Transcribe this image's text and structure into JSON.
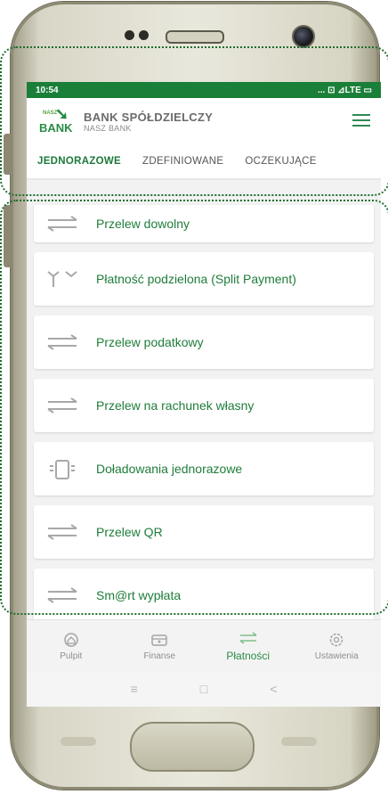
{
  "status_bar": {
    "time": "10:54",
    "indicators": "... ⊡ ⊿LTE ▭"
  },
  "app_bar": {
    "logo_small": "NASZ",
    "logo_text": "BANK",
    "brand_name": "BANK SPÓŁDZIELCZY",
    "brand_sub": "NASZ BANK",
    "menu_icon": "hamburger-icon"
  },
  "tabs": [
    {
      "label": "JEDNORAZOWE",
      "active": true
    },
    {
      "label": "ZDEFINIOWANE",
      "active": false
    },
    {
      "label": "OCZEKUJĄCE",
      "active": false
    }
  ],
  "payment_options": [
    {
      "label": "Przelew dowolny",
      "icon": "transfer-arrows-icon"
    },
    {
      "label": "Płatność podzielona (Split Payment)",
      "icon": "split-payment-icon"
    },
    {
      "label": "Przelew podatkowy",
      "icon": "transfer-arrows-icon"
    },
    {
      "label": "Przelew na rachunek własny",
      "icon": "transfer-arrows-icon"
    },
    {
      "label": "Doładowania jednorazowe",
      "icon": "phone-topup-icon"
    },
    {
      "label": "Przelew QR",
      "icon": "transfer-arrows-icon"
    },
    {
      "label": "Sm@rt wypłata",
      "icon": "transfer-arrows-icon"
    }
  ],
  "bottom_nav": [
    {
      "label": "Pulpit",
      "icon": "home-icon",
      "active": false
    },
    {
      "label": "Finanse",
      "icon": "wallet-icon",
      "active": false
    },
    {
      "label": "Płatności",
      "icon": "transfer-arrows-icon",
      "active": true
    },
    {
      "label": "Ustawienia",
      "icon": "gear-icon",
      "active": false
    }
  ],
  "system_nav": {
    "recent": "≡",
    "home": "□",
    "back": "<"
  },
  "colors": {
    "brand_green": "#1d7a3a",
    "status_bar": "#1a7f38",
    "highlight": "#1d6f2e"
  }
}
